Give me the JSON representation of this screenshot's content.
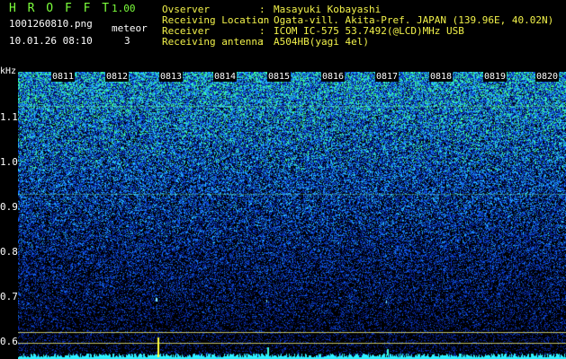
{
  "header": {
    "app_title": "H R O F F T",
    "version": "1.00",
    "file_name": "1001260810.png",
    "mode_label": "meteor",
    "datetime": "10.01.26 08:10",
    "meteor_count": "3"
  },
  "info": [
    {
      "key": "Ovserver",
      "value": "Masayuki Kobayashi"
    },
    {
      "key": "Receiving Location",
      "value": "Ogata-vill. Akita-Pref. JAPAN (139.96E, 40.02N)"
    },
    {
      "key": "Receiver",
      "value": "ICOM IC-575 53.7492(@LCD)MHz USB"
    },
    {
      "key": "Receiving antenna",
      "value": "A504HB(yagi 4el)"
    }
  ],
  "separator": ":",
  "chart_data": {
    "type": "heatmap",
    "ylabel": "kHz",
    "y_ticks": [
      "1.1",
      "1.0",
      "0.9",
      "0.8",
      "0.7",
      "0.6"
    ],
    "x_ticks": [
      "0811",
      "0812",
      "0813",
      "0814",
      "0815",
      "0816",
      "0817",
      "0818",
      "0819",
      "0820"
    ],
    "colors": {
      "background": "#000000",
      "low": "#001a80",
      "mid": "#1a78ff",
      "high": "#36ffe0",
      "peak": "#ffff40"
    }
  }
}
